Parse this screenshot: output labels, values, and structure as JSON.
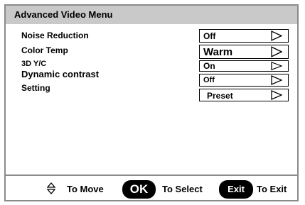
{
  "menu": {
    "title": "Advanced Video Menu",
    "items": [
      {
        "label": "Noise Reduction",
        "value": "Off"
      },
      {
        "label": "Color Temp",
        "value": "Warm"
      },
      {
        "label": "3D Y/C",
        "value": "On"
      },
      {
        "label": "Dynamic contrast",
        "value": "Off"
      },
      {
        "label": "Setting",
        "value": "Preset"
      }
    ]
  },
  "footer": {
    "move_label": "To Move",
    "ok_button": "OK",
    "select_label": "To Select",
    "exit_button": "Exit",
    "exit_label": "To Exit"
  }
}
